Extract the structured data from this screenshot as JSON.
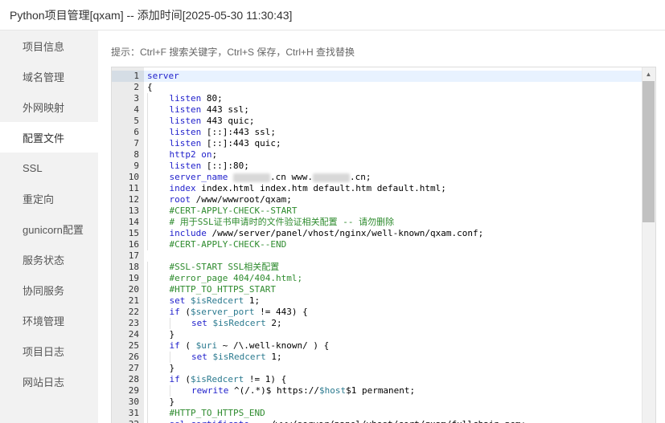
{
  "window": {
    "title": "Python项目管理[qxam] -- 添加时间[2025-05-30 11:30:43]"
  },
  "sidebar": {
    "items": [
      {
        "label": "项目信息",
        "active": false
      },
      {
        "label": "域名管理",
        "active": false
      },
      {
        "label": "外网映射",
        "active": false
      },
      {
        "label": "配置文件",
        "active": true
      },
      {
        "label": "SSL",
        "active": false
      },
      {
        "label": "重定向",
        "active": false
      },
      {
        "label": "gunicorn配置",
        "active": false
      },
      {
        "label": "服务状态",
        "active": false
      },
      {
        "label": "协同服务",
        "active": false
      },
      {
        "label": "环境管理",
        "active": false
      },
      {
        "label": "项目日志",
        "active": false
      },
      {
        "label": "网站日志",
        "active": false
      }
    ]
  },
  "main": {
    "hint": "提示：Ctrl+F 搜索关键字，Ctrl+S 保存，Ctrl+H 查找替换"
  },
  "editor": {
    "active_line": 1,
    "lines": [
      "server",
      "{",
      "    listen 80;",
      "    listen 443 ssl;",
      "    listen 443 quic;",
      "    listen [::]:443 ssl;",
      "    listen [::]:443 quic;",
      "    http2 on;",
      "    listen [::]:80;",
      "    server_name [[BLUR]].cn www.[[BLUR]].cn;",
      "    index index.html index.htm default.htm default.html;",
      "    root /www/wwwroot/qxam;",
      "    #CERT-APPLY-CHECK--START",
      "    # 用于SSL证书申请时的文件验证相关配置 -- 请勿删除",
      "    include /www/server/panel/vhost/nginx/well-known/qxam.conf;",
      "    #CERT-APPLY-CHECK--END",
      "",
      "    #SSL-START SSL相关配置",
      "    #error_page 404/404.html;",
      "    #HTTP_TO_HTTPS_START",
      "    set $isRedcert 1;",
      "    if ($server_port != 443) {",
      "        set $isRedcert 2;",
      "    }",
      "    if ( $uri ~ /\\.well-known/ ) {",
      "        set $isRedcert 1;",
      "    }",
      "    if ($isRedcert != 1) {",
      "        rewrite ^(/.*)$ https://$host$1 permanent;",
      "    }",
      "    #HTTP_TO_HTTPS_END",
      "    ssl_certificate    /www/server/panel/vhost/cert/qxam/fullchain.pem;"
    ]
  },
  "colors": {
    "keyword": "#2222cc",
    "variable": "#2b7a8f",
    "comment": "#2e8b2e",
    "sidebar_bg": "#f2f2f2",
    "gutter_bg": "#ebebeb"
  },
  "icons": {
    "scroll_up": "scroll-up-arrow-icon"
  }
}
